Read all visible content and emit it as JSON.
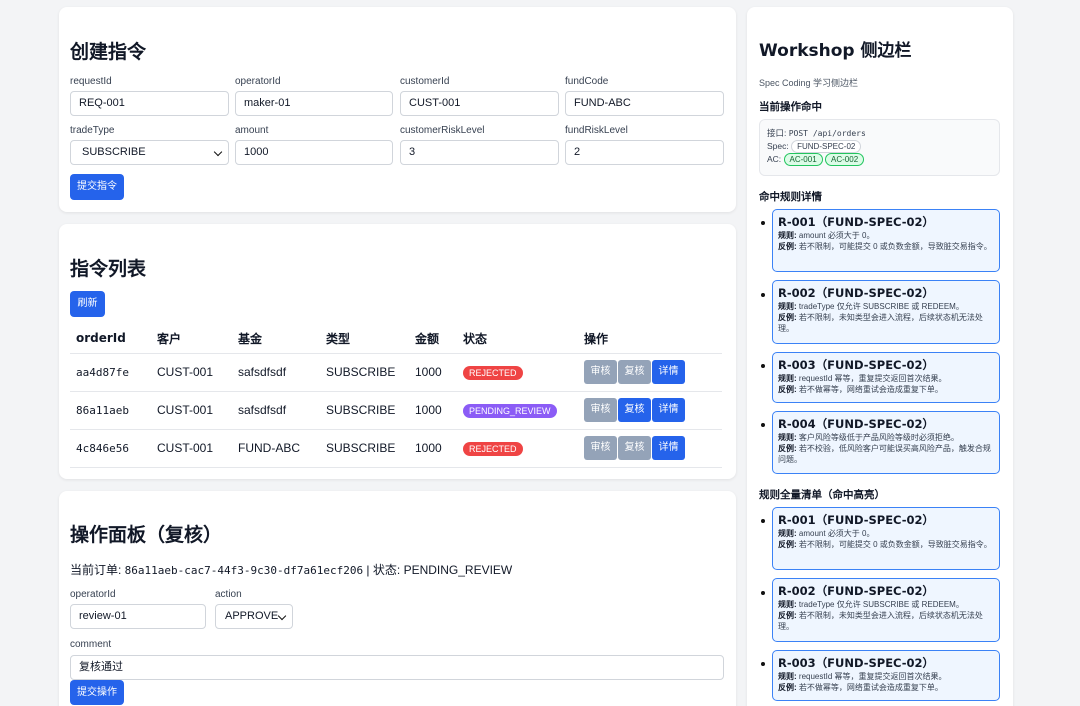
{
  "create": {
    "title": "创建指令",
    "fields": {
      "requestId": {
        "label": "requestId",
        "value": "REQ-001"
      },
      "operatorId": {
        "label": "operatorId",
        "value": "maker-01"
      },
      "customerId": {
        "label": "customerId",
        "value": "CUST-001"
      },
      "fundCode": {
        "label": "fundCode",
        "value": "FUND-ABC"
      },
      "tradeType": {
        "label": "tradeType",
        "value": "SUBSCRIBE"
      },
      "amount": {
        "label": "amount",
        "value": "1000"
      },
      "customerRiskLevel": {
        "label": "customerRiskLevel",
        "value": "3"
      },
      "fundRiskLevel": {
        "label": "fundRiskLevel",
        "value": "2"
      }
    },
    "submit_label": "提交指令"
  },
  "list": {
    "title": "指令列表",
    "refresh_label": "刷新",
    "columns": [
      "orderId",
      "客户",
      "基金",
      "类型",
      "金额",
      "状态",
      "操作"
    ],
    "rows": [
      {
        "orderId": "aa4d87fe",
        "customer": "CUST-001",
        "fund": "safsdfsdf",
        "type": "SUBSCRIBE",
        "amount": "1000",
        "status": "REJECTED"
      },
      {
        "orderId": "86a11aeb",
        "customer": "CUST-001",
        "fund": "safsdfsdf",
        "type": "SUBSCRIBE",
        "amount": "1000",
        "status": "PENDING_REVIEW"
      },
      {
        "orderId": "4c846e56",
        "customer": "CUST-001",
        "fund": "FUND-ABC",
        "type": "SUBSCRIBE",
        "amount": "1000",
        "status": "REJECTED"
      }
    ],
    "actions": {
      "audit": "审核",
      "recheck": "复核",
      "detail": "详情"
    }
  },
  "operation": {
    "title": "操作面板（复核）",
    "current_prefix": "当前订单: ",
    "current_order_id": "86a11aeb-cac7-44f3-9c30-df7a61ecf206",
    "status_prefix": " | 状态: ",
    "status": "PENDING_REVIEW",
    "operatorId": {
      "label": "operatorId",
      "value": "review-01"
    },
    "action": {
      "label": "action",
      "value": "APPROVE"
    },
    "comment": {
      "label": "comment",
      "value": "复核通过"
    },
    "submit_label": "提交操作"
  },
  "sidebar": {
    "title": "Workshop 侧边栏",
    "subtitle": "Spec Coding 学习侧边栏",
    "current_hit_title": "当前操作命中",
    "api_label": "接口: ",
    "api_value": "POST /api/orders",
    "spec_label": "Spec: ",
    "spec_value": "FUND-SPEC-02",
    "ac_label": "AC: ",
    "ac_values": [
      "AC-001",
      "AC-002"
    ],
    "hit_rules_title": "命中规则详情",
    "all_rules_title": "规则全量清单（命中高亮）",
    "rule_label": "规则:",
    "counter_label": "反例:",
    "hit_rules": [
      {
        "title": "R-001（FUND-SPEC-02）",
        "rule": "amount 必须大于 0。",
        "counter": "若不限制，可能提交 0 或负数金额，导致脏交易指令。"
      },
      {
        "title": "R-002（FUND-SPEC-02）",
        "rule": "tradeType 仅允许 SUBSCRIBE 或 REDEEM。",
        "counter": "若不限制，未知类型会进入流程，后续状态机无法处理。"
      },
      {
        "title": "R-003（FUND-SPEC-02）",
        "rule": "requestId 幂等，重复提交返回首次结果。",
        "counter": "若不做幂等，网络重试会造成重复下单。"
      },
      {
        "title": "R-004（FUND-SPEC-02）",
        "rule": "客户风险等级低于产品风险等级时必须拒绝。",
        "counter": "若不校验，低风险客户可能误买高风险产品，触发合规问题。"
      }
    ],
    "all_rules": [
      {
        "title": "R-001（FUND-SPEC-02）",
        "rule": "amount 必须大于 0。",
        "counter": "若不限制，可能提交 0 或负数金额，导致脏交易指令。"
      },
      {
        "title": "R-002（FUND-SPEC-02）",
        "rule": "tradeType 仅允许 SUBSCRIBE 或 REDEEM。",
        "counter": "若不限制，未知类型会进入流程，后续状态机无法处理。"
      },
      {
        "title": "R-003（FUND-SPEC-02）",
        "rule": "requestId 幂等，重复提交返回首次结果。",
        "counter": "若不做幂等，网络重试会造成重复下单。"
      }
    ]
  },
  "colors": {
    "primary": "#2563eb",
    "rejected": "#ef4444",
    "pending": "#8b5cf6",
    "disabled": "#94a3b8",
    "rule_border": "#3b82f6",
    "rule_bg": "#eff6ff"
  }
}
